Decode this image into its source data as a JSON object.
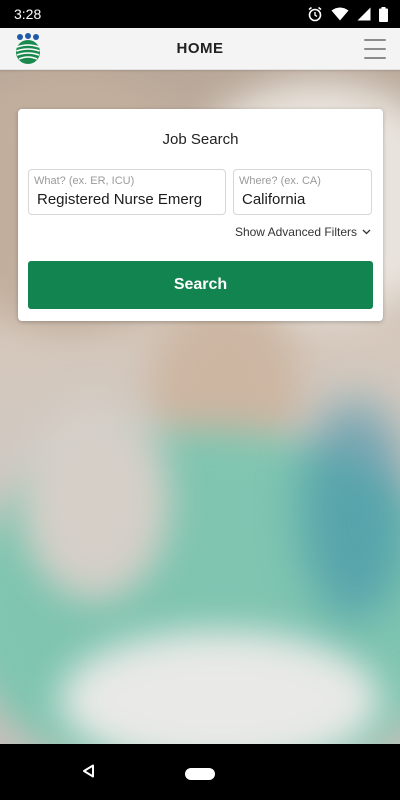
{
  "status_bar": {
    "time": "3:28",
    "icons": [
      "alarm-icon",
      "wifi-icon",
      "signal-icon",
      "battery-icon"
    ]
  },
  "app_bar": {
    "title": "HOME",
    "logo": "company-logo",
    "menu_icon": "hamburger-menu-icon"
  },
  "job_search": {
    "title": "Job Search",
    "what": {
      "placeholder": "What? (ex. ER, ICU)",
      "value": "Registered Nurse Emerg"
    },
    "where": {
      "placeholder": "Where? (ex. CA)",
      "value": "California"
    },
    "advanced_filters_label": "Show Advanced Filters",
    "search_label": "Search"
  },
  "colors": {
    "primary_green": "#128450",
    "app_bar_bg": "#f4f4f4"
  },
  "nav_bar": {
    "icons": [
      "back-icon",
      "home-pill-icon"
    ]
  }
}
